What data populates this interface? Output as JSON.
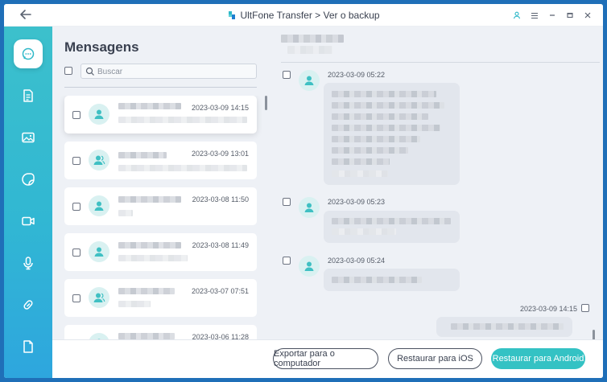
{
  "window": {
    "title": "UltFone Transfer > Ver o backup"
  },
  "icons": {
    "back": "arrow-left-icon",
    "user": "user-icon",
    "menu": "menu-icon",
    "minimize": "minimize-icon",
    "maximize": "maximize-icon",
    "close": "close-icon"
  },
  "sidebar": {
    "items": [
      {
        "name": "messages",
        "icon": "chat-bubble-icon",
        "active": true
      },
      {
        "name": "documents",
        "icon": "document-icon",
        "active": false
      },
      {
        "name": "photos",
        "icon": "image-icon",
        "active": false
      },
      {
        "name": "stickers",
        "icon": "sticker-icon",
        "active": false
      },
      {
        "name": "videos",
        "icon": "video-icon",
        "active": false
      },
      {
        "name": "audio",
        "icon": "microphone-icon",
        "active": false
      },
      {
        "name": "links",
        "icon": "link-icon",
        "active": false
      },
      {
        "name": "files",
        "icon": "file-icon",
        "active": false
      }
    ]
  },
  "messages_panel": {
    "title": "Mensagens",
    "search_placeholder": "Buscar",
    "conversations": [
      {
        "time": "2023-03-09 14:15",
        "selected": true,
        "group": false
      },
      {
        "time": "2023-03-09 13:01",
        "selected": false,
        "group": true
      },
      {
        "time": "2023-03-08 11:50",
        "selected": false,
        "group": false
      },
      {
        "time": "2023-03-08 11:49",
        "selected": false,
        "group": false
      },
      {
        "time": "2023-03-07 07:51",
        "selected": false,
        "group": true
      },
      {
        "time": "2023-03-06 11:28",
        "selected": false,
        "group": false
      }
    ]
  },
  "chat": {
    "messages": [
      {
        "time": "2023-03-09 05:22",
        "direction": "incoming"
      },
      {
        "time": "2023-03-09 05:23",
        "direction": "incoming"
      },
      {
        "time": "2023-03-09 05:24",
        "direction": "incoming"
      },
      {
        "time": "2023-03-09 14:15",
        "direction": "outgoing"
      }
    ]
  },
  "actions": {
    "export_label": "Exportar para o computador",
    "restore_ios_label": "Restaurar para iOS",
    "restore_android_label": "Restaurar para Android"
  },
  "colors": {
    "accent": "#34c2c4",
    "sidebar_top": "#3cc0cc",
    "sidebar_bottom": "#2ea6de",
    "panel_bg": "#eef1f6"
  }
}
